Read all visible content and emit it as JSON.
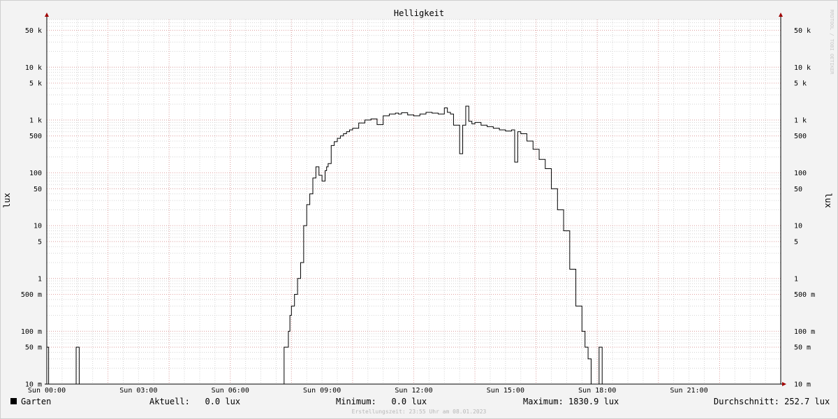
{
  "chart_data": {
    "type": "line",
    "title": "Helligkeit",
    "ylabel": "lux",
    "watermark": "RRDTOOL / TOBI OETIKER",
    "y_scale": "log",
    "ylim": [
      0.01,
      80000
    ],
    "x_start_hour": 0,
    "x_end_hour": 24,
    "x_tick_hours": [
      0,
      3,
      6,
      9,
      12,
      15,
      18,
      21
    ],
    "x_tick_labels": [
      "Sun 00:00",
      "Sun 03:00",
      "Sun 06:00",
      "Sun 09:00",
      "Sun 12:00",
      "Sun 15:00",
      "Sun 18:00",
      "Sun 21:00"
    ],
    "y_tick_values": [
      0.01,
      0.05,
      0.1,
      0.5,
      1,
      5,
      10,
      50,
      100,
      500,
      1000,
      5000,
      10000,
      50000
    ],
    "y_tick_labels": [
      "10 m",
      "50 m",
      "100 m",
      "500 m",
      "1",
      "5",
      "10",
      "50",
      "100",
      "500",
      "1 k",
      "5 k",
      "10 k",
      "50 k"
    ],
    "grid": true,
    "series": [
      {
        "name": "Garten",
        "color": "#000000",
        "x_hours": [
          0,
          0.05,
          0.06,
          0.95,
          0.96,
          1.05,
          1.06,
          7.75,
          7.76,
          7.85,
          7.9,
          7.95,
          8.0,
          8.1,
          8.2,
          8.3,
          8.4,
          8.5,
          8.6,
          8.7,
          8.8,
          8.9,
          9.0,
          9.1,
          9.15,
          9.2,
          9.3,
          9.4,
          9.5,
          9.6,
          9.7,
          9.8,
          9.9,
          10.0,
          10.2,
          10.4,
          10.6,
          10.8,
          11.0,
          11.2,
          11.4,
          11.5,
          11.6,
          11.8,
          12.0,
          12.2,
          12.4,
          12.6,
          12.8,
          13.0,
          13.1,
          13.2,
          13.3,
          13.5,
          13.6,
          13.7,
          13.8,
          13.9,
          14.0,
          14.2,
          14.4,
          14.6,
          14.8,
          15.0,
          15.2,
          15.3,
          15.4,
          15.5,
          15.7,
          15.9,
          16.1,
          16.3,
          16.5,
          16.7,
          16.9,
          17.1,
          17.3,
          17.5,
          17.6,
          17.7,
          17.8,
          17.85,
          17.9,
          17.95,
          18.0,
          18.05,
          18.06,
          18.15,
          18.16,
          24
        ],
        "values": [
          0.05,
          0.05,
          0.01,
          0.01,
          0.05,
          0.05,
          0.01,
          0.01,
          0.05,
          0.05,
          0.1,
          0.2,
          0.3,
          0.5,
          1.0,
          2.0,
          10.0,
          25.0,
          40.0,
          80.0,
          130.0,
          90.0,
          70.0,
          110.0,
          130.0,
          150.0,
          330.0,
          390.0,
          450.0,
          500.0,
          550.0,
          600.0,
          650.0,
          700.0,
          880.0,
          1000.0,
          1050.0,
          820.0,
          1200.0,
          1300.0,
          1350.0,
          1300.0,
          1380.0,
          1250.0,
          1200.0,
          1300.0,
          1400.0,
          1350.0,
          1300.0,
          1700.0,
          1400.0,
          1300.0,
          800.0,
          230.0,
          800.0,
          1830.0,
          950.0,
          850.0,
          900.0,
          800.0,
          750.0,
          700.0,
          650.0,
          620.0,
          650.0,
          160.0,
          600.0,
          550.0,
          400.0,
          280.0,
          180.0,
          120.0,
          50.0,
          20.0,
          8.0,
          1.5,
          0.3,
          0.1,
          0.05,
          0.03,
          0.01,
          0.01,
          0.01,
          0.01,
          0.01,
          0.01,
          0.05,
          0.05,
          0.01,
          0.01
        ]
      }
    ]
  },
  "legend": {
    "series_name": "Garten",
    "current": "Aktuell:   0.0 lux",
    "minimum": "Minimum:   0.0 lux",
    "maximum": "Maximum: 1830.9 lux",
    "average": "Durchschnitt: 252.7 lux"
  },
  "footer": "Erstellungszeit: 23:55 Uhr am 08.01.2023"
}
